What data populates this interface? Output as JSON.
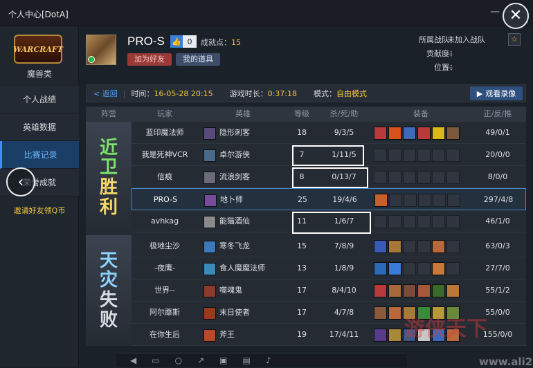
{
  "window": {
    "title": "个人中心[DotA]",
    "minimize_glyph": "—",
    "close_glyph": "✕"
  },
  "sidebar": {
    "logo_text": "WARCRAFT",
    "game_name": "魔兽类",
    "items": [
      {
        "label": "个人战绩",
        "active": false
      },
      {
        "label": "英雄数据",
        "active": false
      },
      {
        "label": "比赛记录",
        "active": true
      },
      {
        "label": "荣誉成就",
        "active": false
      }
    ],
    "invite": "邀请好友领Q币",
    "back_glyph": "‹"
  },
  "profile": {
    "name": "PRO-S",
    "likes": "0",
    "achievement_label": "成就点：",
    "achievement_value": "15",
    "add_friend": "加为好友",
    "my_items": "我的道具",
    "team_label": "所属战队：",
    "team_value": "未加入战队",
    "contrib_label": "贡献度：",
    "contrib_value": "--",
    "position_label": "位置：",
    "position_value": "--"
  },
  "match": {
    "back": "< 返回",
    "time_label": "时间：",
    "time_value": "16-05-28 20:15",
    "duration_label": "游戏时长：",
    "duration_value": "0:37:18",
    "mode_label": "模式：",
    "mode_value": "自由模式",
    "replay": "观看录像"
  },
  "table": {
    "headers": [
      "阵营",
      "玩家",
      "英雄",
      "等级",
      "杀/死/助",
      "装备",
      "正/反/推"
    ],
    "camps": {
      "sentinel": [
        "近",
        "卫",
        "胜",
        "利"
      ],
      "scourge": [
        "天",
        "灾",
        "失",
        "败"
      ]
    },
    "rows": [
      {
        "player": "蓝印魔法师",
        "hero": "隐形刺客",
        "level": "18",
        "kda": "9/3/5",
        "cs": "49/0/1",
        "hero_color": "#5a4a7a",
        "items": [
          "#b83a3a",
          "#d8501a",
          "#3a6ab8",
          "#b83a3a",
          "#d8b81a",
          "#7a5a3a"
        ]
      },
      {
        "player": "我是死神VCR",
        "hero": "卓尔游侠",
        "level": "7",
        "kda": "1/11/5",
        "cs": "20/0/0",
        "hero_color": "#4a6a8a",
        "items": []
      },
      {
        "player": "信痕",
        "hero": "流浪剑客",
        "level": "8",
        "kda": "0/13/7",
        "cs": "8/0/0",
        "hero_color": "#6a6a7a",
        "items": []
      },
      {
        "player": "PRO-S",
        "hero": "地卜师",
        "level": "25",
        "kda": "19/4/6",
        "cs": "297/4/8",
        "hero_color": "#7a4a9a",
        "items": [
          "#c8602a"
        ]
      },
      {
        "player": "avhkag",
        "hero": "能猫酒仙",
        "level": "11",
        "kda": "1/6/7",
        "cs": "46/1/0",
        "hero_color": "#8a8a8a",
        "items": []
      },
      {
        "player": "极地尘沙",
        "hero": "寒冬飞龙",
        "level": "15",
        "kda": "7/8/9",
        "cs": "63/0/3",
        "hero_color": "#3a7ab8",
        "items": [
          "#3a5ab8",
          "#a8783a",
          "",
          "",
          "#b8683a",
          "",
          "#8a4a2a"
        ]
      },
      {
        "player": "-夜鹰-",
        "hero": "食人魔魔法师",
        "level": "13",
        "kda": "1/8/9",
        "cs": "27/7/0",
        "hero_color": "#3a8ab8",
        "items": [
          "#2a6ab8",
          "#3a7ad8",
          "",
          "",
          "#c8783a",
          "",
          "#b84a3a"
        ]
      },
      {
        "player": "世界--",
        "hero": "噬魂鬼",
        "level": "17",
        "kda": "8/4/10",
        "cs": "55/1/2",
        "hero_color": "#8a3a2a",
        "items": [
          "#b83a3a",
          "#a86a3a",
          "#7a4a3a",
          "#a8583a",
          "#3a6a2a",
          "#b8783a"
        ]
      },
      {
        "player": "阿尔蘼斯",
        "hero": "末日使者",
        "level": "17",
        "kda": "4/7/8",
        "cs": "55/0/0",
        "hero_color": "#9a3a1a",
        "items": [
          "#8a5a3a",
          "#b8683a",
          "#a87a3a",
          "#3a8a3a",
          "#b8983a",
          "#6a8a3a"
        ]
      },
      {
        "player": "在你生后",
        "hero": "斧王",
        "level": "19",
        "kda": "17/4/11",
        "cs": "155/0/0",
        "hero_color": "#b84a2a",
        "items": [
          "#5a3a8a",
          "#a8883a",
          "#3a5a8a",
          "#c8c8c8",
          "#3a6ab8",
          "#b8683a"
        ]
      }
    ]
  },
  "watermark": {
    "main": "游侠天下",
    "site": "www.ali213.net"
  }
}
